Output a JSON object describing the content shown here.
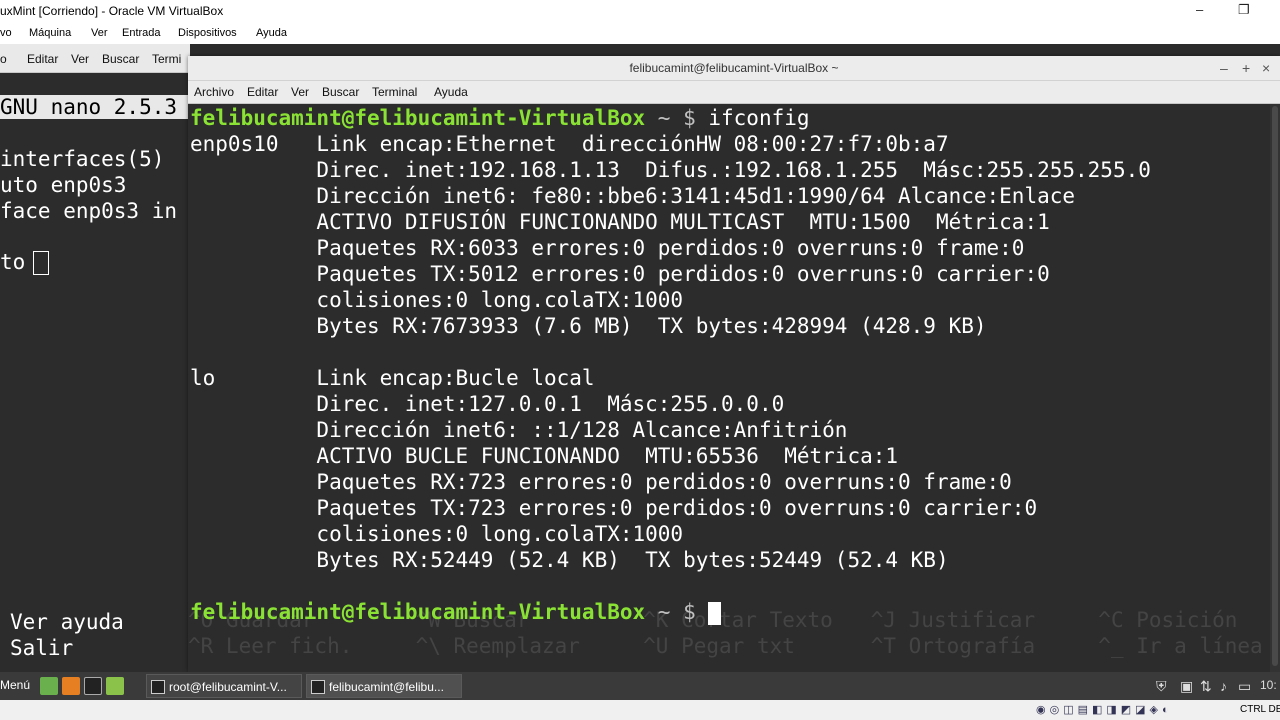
{
  "vbox": {
    "title": "uxMint [Corriendo] - Oracle VM VirtualBox",
    "menu": [
      "vo",
      "Máquina",
      "Ver",
      "Entrada",
      "Dispositivos",
      "Ayuda"
    ],
    "host_key": "CTRL DE",
    "win_minimize": "–",
    "win_restore": "❐"
  },
  "bg_terminal": {
    "menu": [
      "o",
      "Editar",
      "Ver",
      "Buscar",
      "Termi"
    ],
    "lines": [
      "GNU nano 2.5.3",
      "interfaces(5)",
      "uto enp0s3",
      "face enp0s3 in",
      "to",
      "Ver ayuda",
      "Salir"
    ]
  },
  "fg_terminal": {
    "title": "felibucamint@felibucamint-VirtualBox ~",
    "menu": [
      "Archivo",
      "Editar",
      "Ver",
      "Buscar",
      "Terminal",
      "Ayuda"
    ],
    "prompt_user": "felibucamint@felibucamint-VirtualBox",
    "prompt_path": " ~ $ ",
    "command": "ifconfig",
    "output": [
      "enp0s10   Link encap:Ethernet  direcciónHW 08:00:27:f7:0b:a7",
      "          Direc. inet:192.168.1.13  Difus.:192.168.1.255  Másc:255.255.255.0",
      "          Dirección inet6: fe80::bbe6:3141:45d1:1990/64 Alcance:Enlace",
      "          ACTIVO DIFUSIÓN FUNCIONANDO MULTICAST  MTU:1500  Métrica:1",
      "          Paquetes RX:6033 errores:0 perdidos:0 overruns:0 frame:0",
      "          Paquetes TX:5012 errores:0 perdidos:0 overruns:0 carrier:0",
      "          colisiones:0 long.colaTX:1000",
      "          Bytes RX:7673933 (7.6 MB)  TX bytes:428994 (428.9 KB)",
      "",
      "lo        Link encap:Bucle local",
      "          Direc. inet:127.0.0.1  Másc:255.0.0.0",
      "          Dirección inet6: ::1/128 Alcance:Anfitrión",
      "          ACTIVO BUCLE FUNCIONANDO  MTU:65536  Métrica:1",
      "          Paquetes RX:723 errores:0 perdidos:0 overruns:0 frame:0",
      "          Paquetes TX:723 errores:0 perdidos:0 overruns:0 carrier:0",
      "          colisiones:0 long.colaTX:1000",
      "          Bytes RX:52449 (52.4 KB)  TX bytes:52449 (52.4 KB)"
    ],
    "ghost_row1": "^O Guardar        ^W Buscar         ^K Cortar Texto   ^J Justificar     ^C Posición",
    "ghost_row2": "^R Leer fich.     ^\\ Reemplazar     ^U Pegar txt      ^T Ortografía     ^_ Ir a línea"
  },
  "taskbar": {
    "menu_label": "Menú",
    "tasks": [
      "root@felibucamint-V...",
      "felibucamint@felibu..."
    ],
    "clock": "10:"
  }
}
